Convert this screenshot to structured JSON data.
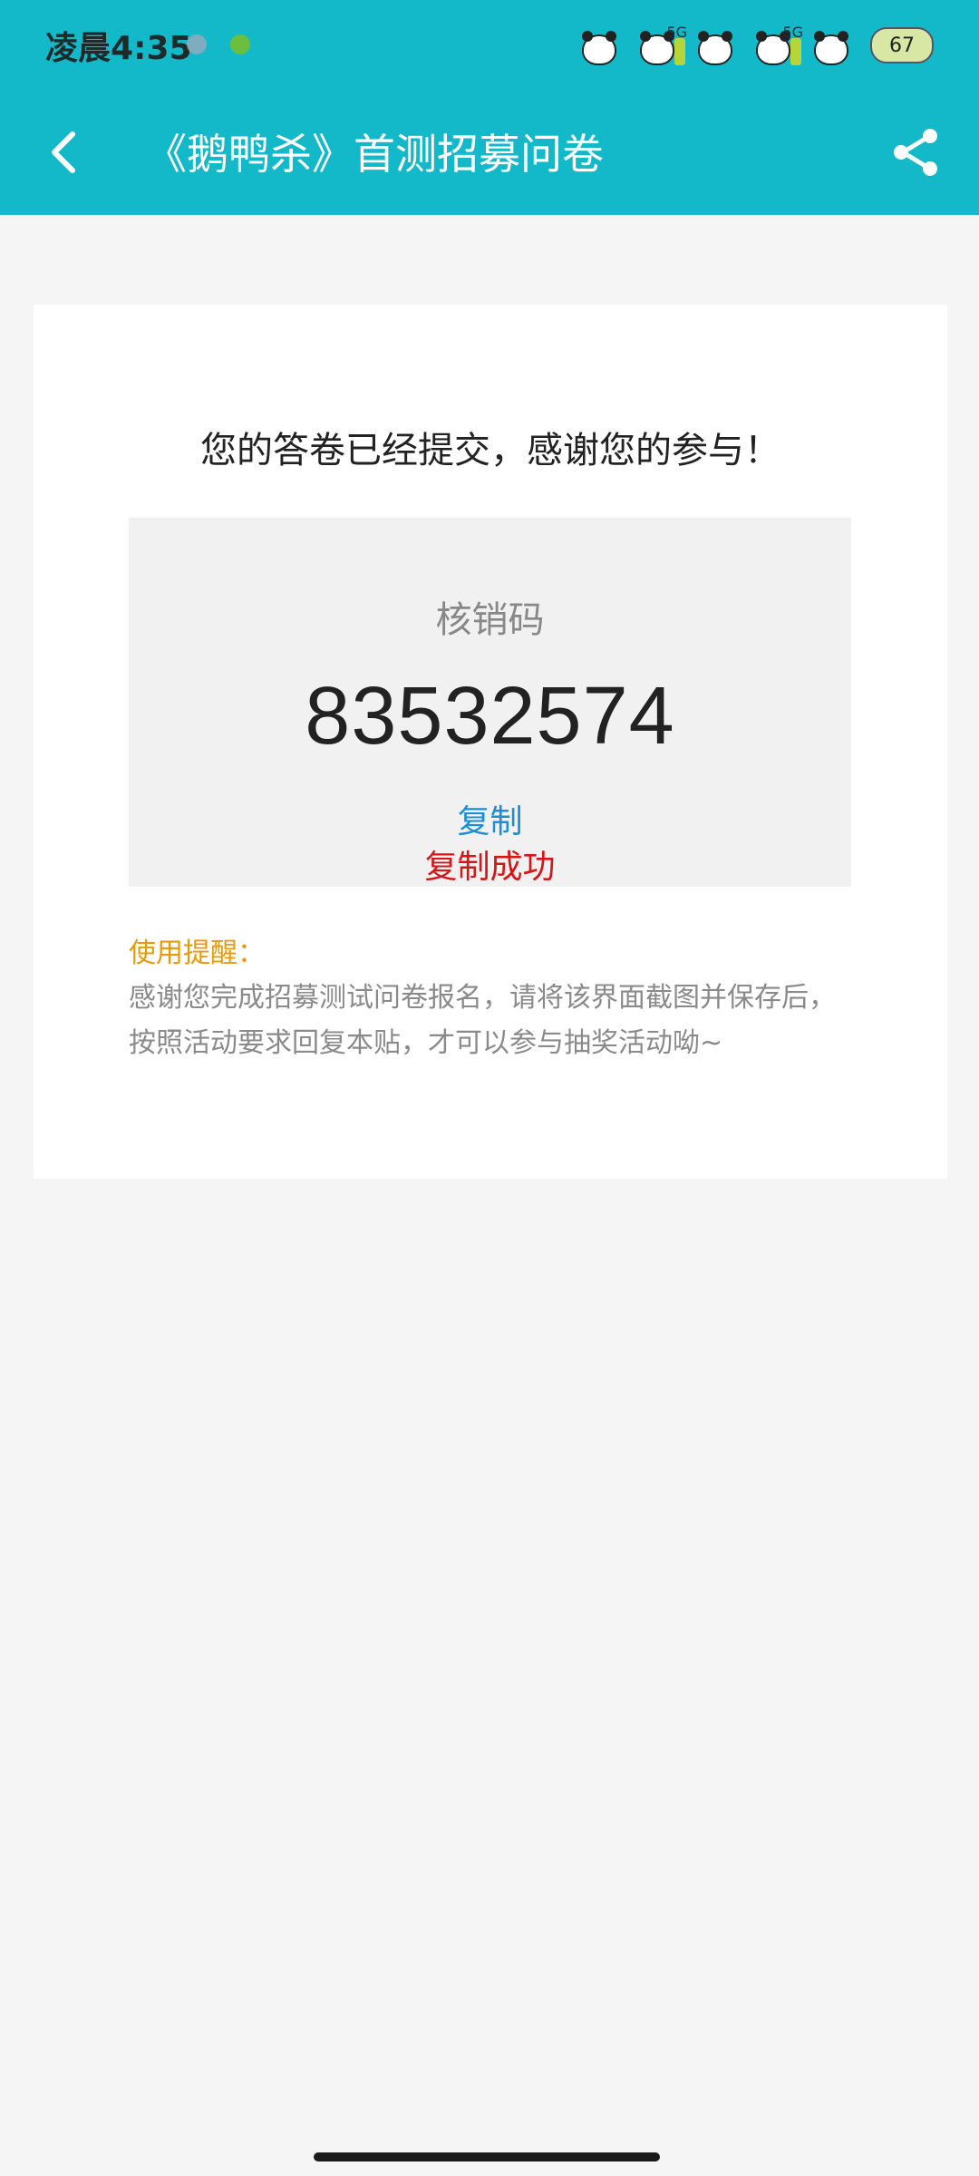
{
  "status_bar": {
    "time": "凌晨4:35",
    "signal_1_label": "5G",
    "signal_2_label": "5G",
    "battery": "67"
  },
  "app_bar": {
    "title": "《鹅鸭杀》首测招募问卷",
    "back_icon": "chevron-left-icon",
    "share_icon": "share-icon",
    "background_color": "#13b9c8"
  },
  "result": {
    "thanks_message": "您的答卷已经提交，感谢您的参与！",
    "code_label": "核销码",
    "code_value": "83532574",
    "copy_label": "复制",
    "copy_success": "复制成功"
  },
  "reminder": {
    "title": "使用提醒：",
    "body": "感谢您完成招募测试问卷报名，请将该界面截图并保存后，按照活动要求回复本贴，才可以参与抽奖活动呦~"
  },
  "colors": {
    "accent": "#13b9c8",
    "link": "#1a8fd6",
    "success_red": "#d61616",
    "reminder_orange": "#e89a0c"
  }
}
